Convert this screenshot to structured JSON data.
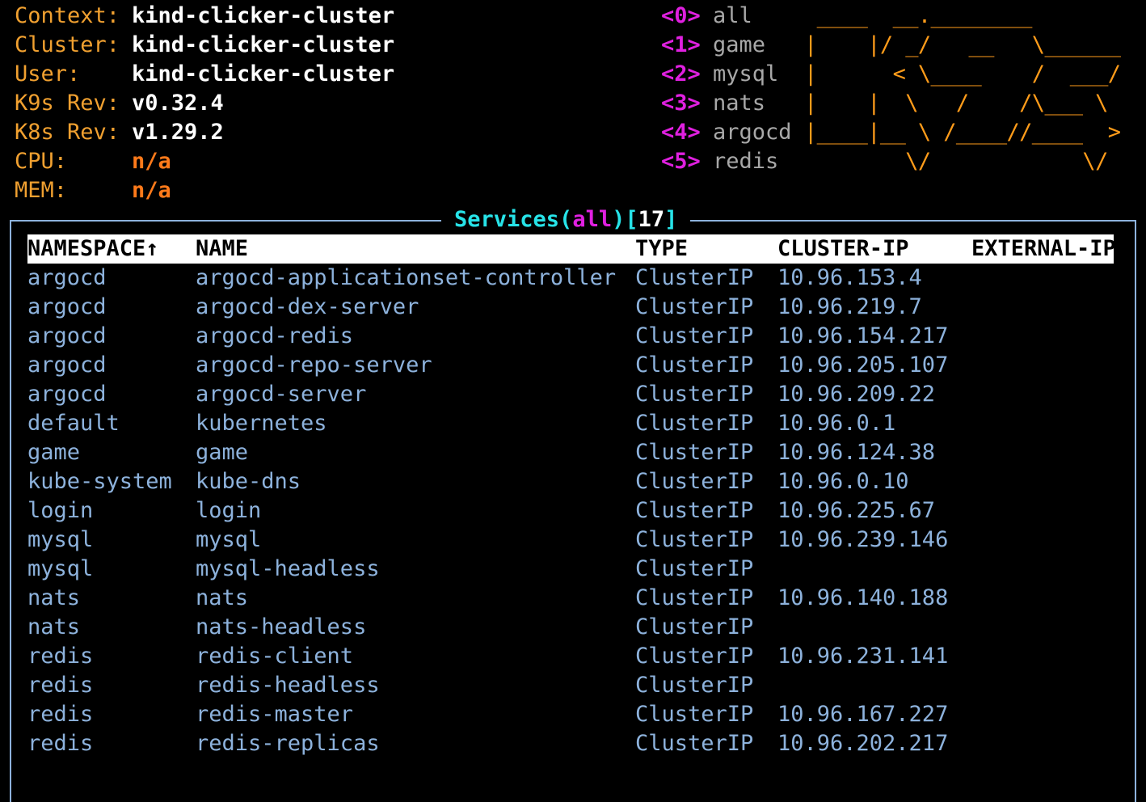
{
  "header": {
    "info": [
      {
        "key": "Context:",
        "value": "kind-clicker-cluster",
        "kind": "normal"
      },
      {
        "key": "Cluster:",
        "value": "kind-clicker-cluster",
        "kind": "normal"
      },
      {
        "key": "User:",
        "value": "kind-clicker-cluster",
        "kind": "normal"
      },
      {
        "key": "K9s Rev:",
        "value": "v0.32.4",
        "kind": "normal"
      },
      {
        "key": "K8s Rev:",
        "value": "v1.29.2",
        "kind": "normal"
      },
      {
        "key": "CPU:",
        "value": "n/a",
        "kind": "na"
      },
      {
        "key": "MEM:",
        "value": "n/a",
        "kind": "na"
      }
    ],
    "namespaces": [
      {
        "key": "<0>",
        "name": "all"
      },
      {
        "key": "<1>",
        "name": "game"
      },
      {
        "key": "<2>",
        "name": "mysql"
      },
      {
        "key": "<3>",
        "name": "nats"
      },
      {
        "key": "<4>",
        "name": "argocd"
      },
      {
        "key": "<5>",
        "name": "redis"
      }
    ],
    "logo_art": " ____  __.________        \n|    |/ _/   __   \\______\n|      < \\____    /  ___/\n|    |  \\   /    /\\___ \\ \n|____|__ \\ /____//____  >\n        \\/            \\/ "
  },
  "view": {
    "title_resource": "Services",
    "title_open": "(",
    "title_namespace": "all",
    "title_close": ")",
    "count_open": "[",
    "count": "17",
    "count_close": "]"
  },
  "table": {
    "columns": [
      "NAMESPACE↑",
      "NAME",
      "TYPE",
      "CLUSTER-IP",
      "EXTERNAL-IP"
    ],
    "rows": [
      [
        "argocd",
        "argocd-applicationset-controller",
        "ClusterIP",
        "10.96.153.4",
        ""
      ],
      [
        "argocd",
        "argocd-dex-server",
        "ClusterIP",
        "10.96.219.7",
        ""
      ],
      [
        "argocd",
        "argocd-redis",
        "ClusterIP",
        "10.96.154.217",
        ""
      ],
      [
        "argocd",
        "argocd-repo-server",
        "ClusterIP",
        "10.96.205.107",
        ""
      ],
      [
        "argocd",
        "argocd-server",
        "ClusterIP",
        "10.96.209.22",
        ""
      ],
      [
        "default",
        "kubernetes",
        "ClusterIP",
        "10.96.0.1",
        ""
      ],
      [
        "game",
        "game",
        "ClusterIP",
        "10.96.124.38",
        ""
      ],
      [
        "kube-system",
        "kube-dns",
        "ClusterIP",
        "10.96.0.10",
        ""
      ],
      [
        "login",
        "login",
        "ClusterIP",
        "10.96.225.67",
        ""
      ],
      [
        "mysql",
        "mysql",
        "ClusterIP",
        "10.96.239.146",
        ""
      ],
      [
        "mysql",
        "mysql-headless",
        "ClusterIP",
        "",
        ""
      ],
      [
        "nats",
        "nats",
        "ClusterIP",
        "10.96.140.188",
        ""
      ],
      [
        "nats",
        "nats-headless",
        "ClusterIP",
        "",
        ""
      ],
      [
        "redis",
        "redis-client",
        "ClusterIP",
        "10.96.231.141",
        ""
      ],
      [
        "redis",
        "redis-headless",
        "ClusterIP",
        "",
        ""
      ],
      [
        "redis",
        "redis-master",
        "ClusterIP",
        "10.96.167.227",
        ""
      ],
      [
        "redis",
        "redis-replicas",
        "ClusterIP",
        "10.96.202.217",
        ""
      ]
    ]
  },
  "colors": {
    "info_key": "#f0a030",
    "na_value": "#ff7a1a",
    "namespace_key": "#e020e0",
    "logo": "#ff9c1a",
    "frame": "#8db2dc",
    "title": "#27e3e8",
    "row_text": "#8db2dc"
  }
}
